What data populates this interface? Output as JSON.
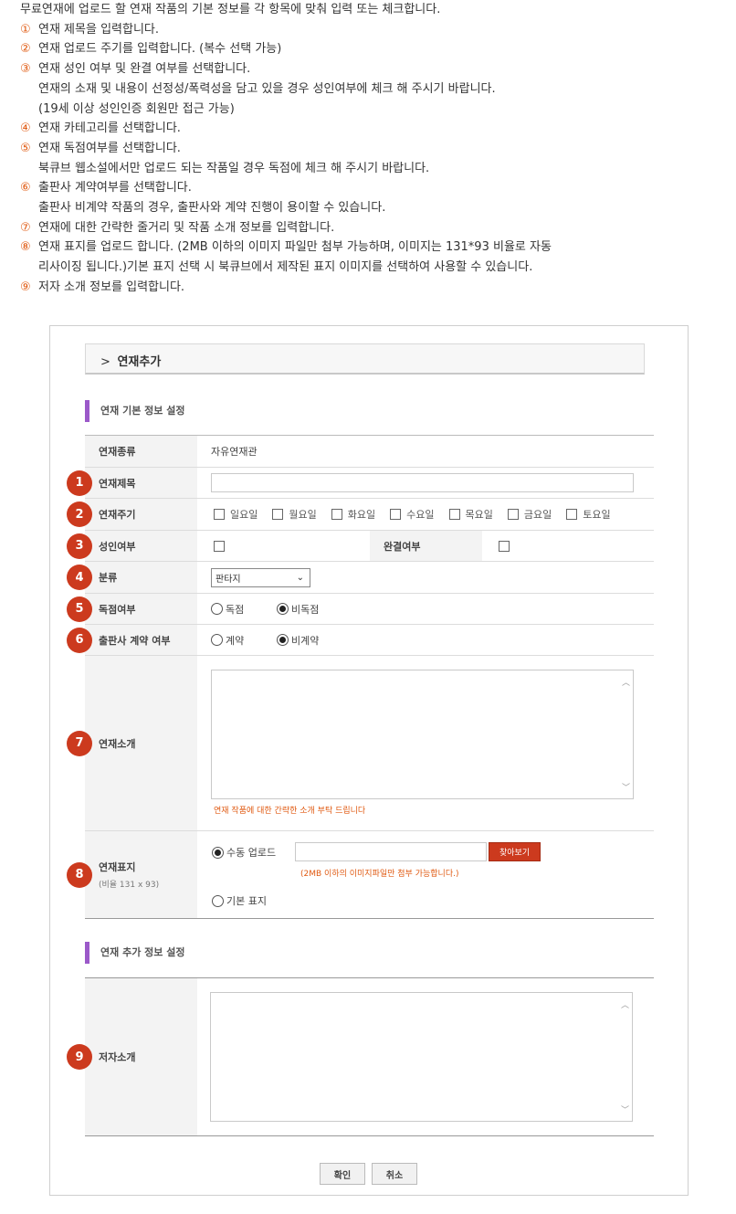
{
  "instructions": {
    "intro": "무료연재에 업로드 할 연재 작품의 기본 정보를 각 항목에 맞춰 입력 또는 체크합니다.",
    "steps": [
      {
        "num": "①",
        "lines": [
          "연재 제목을 입력합니다."
        ]
      },
      {
        "num": "②",
        "lines": [
          "연재 업로드 주기를 입력합니다. (복수 선택 가능)"
        ]
      },
      {
        "num": "③",
        "lines": [
          "연재 성인 여부 및 완결 여부를 선택합니다.",
          "연재의 소재 및 내용이 선정성/폭력성을 담고 있을 경우 성인여부에 체크 해 주시기 바랍니다.",
          "(19세 이상 성인인증 회원만 접근 가능)"
        ]
      },
      {
        "num": "④",
        "lines": [
          "연재 카테고리를 선택합니다."
        ]
      },
      {
        "num": "⑤",
        "lines": [
          "연재 독점여부를 선택합니다.",
          "북큐브 웹소설에서만 업로드 되는 작품일 경우 독점에 체크 해 주시기 바랍니다."
        ]
      },
      {
        "num": "⑥",
        "lines": [
          "출판사 계약여부를 선택합니다.",
          "출판사 비계약 작품의 경우, 출판사와 계약 진행이 용이할 수 있습니다."
        ]
      },
      {
        "num": "⑦",
        "lines": [
          "연재에 대한 간략한 줄거리 및 작품 소개 정보를 입력합니다."
        ]
      },
      {
        "num": "⑧",
        "lines": [
          "연재 표지를 업로드 합니다. (2MB 이하의 이미지 파일만 첨부 가능하며, 이미지는 131*93 비율로 자동",
          "리사이징 됩니다.)기본 표지 선택 시 북큐브에서 제작된 표지 이미지를 선택하여 사용할 수 있습니다."
        ]
      },
      {
        "num": "⑨",
        "lines": [
          "저자 소개 정보를 입력합니다."
        ]
      }
    ]
  },
  "breadcrumb": {
    "chevron": ">",
    "label": "연재추가"
  },
  "section_basic": "연재 기본 정보 설정",
  "section_extra": "연재 추가 정보 설정",
  "form": {
    "type_label": "연재종류",
    "type_value": "자유연재관",
    "title_label": "연재제목",
    "title_value": "",
    "cycle_label": "연재주기",
    "days": [
      "일요일",
      "월요일",
      "화요일",
      "수요일",
      "목요일",
      "금요일",
      "토요일"
    ],
    "adult_label": "성인여부",
    "complete_label": "완결여부",
    "category_label": "분류",
    "category_value": "판타지",
    "exclusive_label": "독점여부",
    "exclusive_options": [
      "독점",
      "비독점"
    ],
    "exclusive_selected": 1,
    "contract_label": "출판사 계약 여부",
    "contract_options": [
      "계약",
      "비계약"
    ],
    "contract_selected": 1,
    "intro_label": "연재소개",
    "intro_hint": "연재 작품에 대한 간략한 소개 부탁 드립니다",
    "cover_label": "연재표지",
    "cover_ratio": "(비율 131 x 93)",
    "cover_upload_label": "수동 업로드",
    "cover_find_button": "찾아보기",
    "cover_hint": "(2MB 이하의 이미지파일만 첨부 가능합니다.)",
    "cover_default_label": "기본 표지",
    "author_label": "저자소개"
  },
  "numbers": [
    "1",
    "2",
    "3",
    "4",
    "5",
    "6",
    "7",
    "8",
    "9"
  ],
  "buttons": {
    "confirm": "확인",
    "cancel": "취소"
  },
  "colors": {
    "accent": "#cc3a1e",
    "section_bar": "#9b59c9",
    "hint": "#e05a12"
  }
}
